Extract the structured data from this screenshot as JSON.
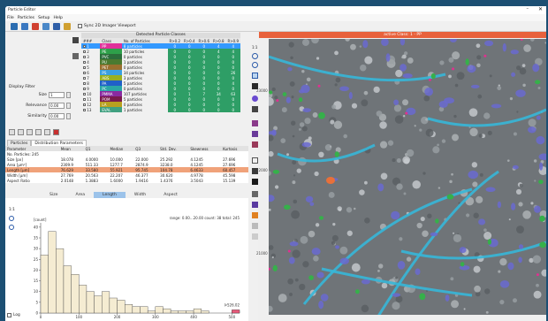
{
  "window": {
    "title": "Particle Editor",
    "minimize": "–",
    "close": "✕"
  },
  "menu": [
    "File",
    "Particles",
    "Setup",
    "Help"
  ],
  "toolbar": {
    "sync_label": "Sync 2D Imager Viewport"
  },
  "classes": {
    "header": "Detected Particle Classes",
    "columns": [
      "###",
      "Class",
      "No. of Particles",
      "R>0.2",
      "R>0.4",
      "R>0.6",
      "R>0.8",
      "R>0.9"
    ],
    "rows": [
      {
        "id": "1",
        "name": "PP",
        "count": "8 particles",
        "v": [
          "0",
          "0",
          "0",
          "4",
          "4"
        ],
        "color": "#e0309a",
        "selected": true
      },
      {
        "id": "2",
        "name": "PE",
        "count": "10 particles",
        "v": [
          "0",
          "0",
          "0",
          "4",
          "4"
        ],
        "color": "#2ea04a"
      },
      {
        "id": "3",
        "name": "PVC",
        "count": "0 particles",
        "v": [
          "0",
          "0",
          "0",
          "0",
          "0"
        ],
        "color": "#2b6d3b"
      },
      {
        "id": "4",
        "name": "PU",
        "count": "1 particles",
        "v": [
          "0",
          "0",
          "0",
          "0",
          "0"
        ],
        "color": "#4a7a30"
      },
      {
        "id": "5",
        "name": "PET",
        "count": "0 particles",
        "v": [
          "0",
          "0",
          "0",
          "0",
          "0"
        ],
        "color": "#9a6f2e"
      },
      {
        "id": "6",
        "name": "PS",
        "count": "34 particles",
        "v": [
          "0",
          "0",
          "0",
          "0",
          "26"
        ],
        "color": "#3aa0e0"
      },
      {
        "id": "7",
        "name": "ABS",
        "count": "3 particles",
        "v": [
          "0",
          "0",
          "0",
          "0",
          "0"
        ],
        "color": "#9ab020"
      },
      {
        "id": "8",
        "name": "PA",
        "count": "5 particles",
        "v": [
          "0",
          "0",
          "0",
          "0",
          "4"
        ],
        "color": "#2060c8"
      },
      {
        "id": "9",
        "name": "PC",
        "count": "0 particles",
        "v": [
          "0",
          "0",
          "0",
          "0",
          "0"
        ],
        "color": "#2aa6a6"
      },
      {
        "id": "10",
        "name": "PMMA",
        "count": "107 particles",
        "v": [
          "0",
          "1",
          "7",
          "34",
          "63"
        ],
        "color": "#8a2aa0"
      },
      {
        "id": "11",
        "name": "POM",
        "count": "5 particles",
        "v": [
          "0",
          "0",
          "0",
          "0",
          "0"
        ],
        "color": "#7a1a4a"
      },
      {
        "id": "12",
        "name": "LA",
        "count": "0 particles",
        "v": [
          "0",
          "0",
          "0",
          "0",
          "0"
        ],
        "color": "#b8a020"
      },
      {
        "id": "13",
        "name": "EVAL",
        "count": "1 particles",
        "v": [
          "0",
          "0",
          "0",
          "0",
          "0"
        ],
        "color": "#40a080"
      }
    ]
  },
  "filter": {
    "title": "Display Filter",
    "size_label": "Size",
    "size_val": "1",
    "relevance_label": "Relevance",
    "relevance_val": "0.00",
    "similarity_label": "Similarity",
    "similarity_val": "0.00"
  },
  "tabs": [
    "Particles",
    "Distribution Parameters"
  ],
  "stats": {
    "columns": [
      "Parameter",
      "Mean",
      "Q1",
      "Median",
      "Q3",
      "Std. Dev.",
      "Skewness",
      "Kurtosis"
    ],
    "rows": [
      [
        "No. Particles: 245",
        "",
        "",
        "",
        "",
        "",
        "",
        ""
      ],
      [
        "Size [px]",
        "18.078",
        "4.0000",
        "10.000",
        "22.000",
        "25.292",
        "4.1245",
        "27.696"
      ],
      [
        "Area [µm²]",
        "2309.9",
        "511.33",
        "1277.7",
        "2874.9",
        "3238.0",
        "4.1245",
        "27.696"
      ],
      [
        "Length [µm]",
        "76.629",
        "33.580",
        "55.921",
        "95.745",
        "104.78",
        "6.4633",
        "60.457"
      ],
      [
        "Width [µm]",
        "27.769",
        "20.563",
        "22.207",
        "46.377",
        "30.620",
        "4.9778",
        "45.598"
      ],
      [
        "Aspect Ratio",
        "2.0148",
        "1.3883",
        "1.6000",
        "1.9416",
        "1.4376",
        "3.5043",
        "15.139"
      ]
    ],
    "highlight_row": 3
  },
  "hist_tabs": [
    "Size",
    "Area",
    "Length",
    "Width",
    "Aspect"
  ],
  "hist": {
    "ylabel": "[count]",
    "range_text": "range: 0.00...20.00 count: 38 total: 245",
    "overflow_label": "ᐅ526.02",
    "log_label": "Log",
    "zoom_label": "1:1"
  },
  "chart_data": {
    "type": "bar",
    "xlabel": "",
    "ylabel": "[count]",
    "xlim": [
      0,
      520
    ],
    "ylim": [
      0,
      42
    ],
    "x_ticks": [
      0,
      100,
      200,
      300,
      400,
      500
    ],
    "y_ticks": [
      0,
      5,
      10,
      15,
      20,
      25,
      30,
      35,
      40
    ],
    "bin_width": 20,
    "values": [
      27,
      38,
      30,
      22,
      18,
      13,
      10,
      8,
      10,
      7,
      6,
      4,
      3,
      3,
      1,
      3,
      2,
      1,
      1,
      1,
      2,
      1,
      0,
      0,
      0,
      1
    ]
  },
  "image": {
    "header": "active Class: 1 - PP",
    "zoom_label": "1:1",
    "y_ticks": [
      "23000",
      "22000",
      "21000"
    ],
    "x_ticks": [
      "39000",
      "40000",
      "40000",
      "41000"
    ]
  }
}
